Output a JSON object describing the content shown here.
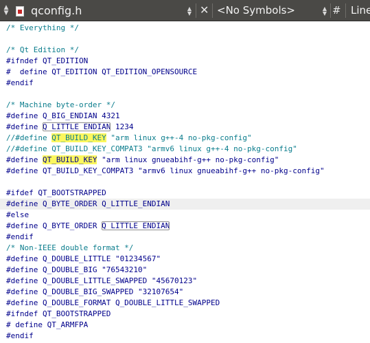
{
  "toolbar": {
    "file_name": "qconfig.h",
    "symbols_label": "<No Symbols>",
    "close_glyph": "✕",
    "hash_glyph": "#",
    "line_label": "Line"
  },
  "code_lines": [
    "/* Everything */",
    "",
    "/* Qt Edition */",
    "#ifndef QT_EDITION",
    "#  define QT_EDITION QT_EDITION_OPENSOURCE",
    "#endif",
    "",
    "/* Machine byte-order */",
    "#define Q_BIG_ENDIAN 4321",
    "#define Q_LITTLE_ENDIAN 1234",
    "//#define QT_BUILD_KEY \"arm linux g++-4 no-pkg-config\"",
    "//#define QT_BUILD_KEY_COMPAT3 \"armv6 linux g++-4 no-pkg-config\"",
    "#define QT_BUILD_KEY \"arm linux gnueabihf-g++ no-pkg-config\"",
    "#define QT_BUILD_KEY_COMPAT3 \"armv6 linux gnueabihf-g++ no-pkg-config\"",
    "",
    "#ifdef QT_BOOTSTRAPPED",
    "#define Q_BYTE_ORDER Q_LITTLE_ENDIAN",
    "#else",
    "#define Q_BYTE_ORDER Q_LITTLE_ENDIAN",
    "#endif",
    "/* Non-IEEE double format */",
    "#define Q_DOUBLE_LITTLE \"01234567\"",
    "#define Q_DOUBLE_BIG \"76543210\"",
    "#define Q_DOUBLE_LITTLE_SWAPPED \"45670123\"",
    "#define Q_DOUBLE_BIG_SWAPPED \"32107654\"",
    "#define Q_DOUBLE_FORMAT Q_DOUBLE_LITTLE_SWAPPED",
    "#ifndef QT_BOOTSTRAPPED",
    "# define QT_ARMFPA",
    "#endif"
  ],
  "colors": {
    "toolbar_bg": "#4a4946",
    "comment": "#0a7c8c",
    "preprocessor": "#00008b",
    "search_highlight": "#fcf75e",
    "current_line": "#efefef"
  }
}
